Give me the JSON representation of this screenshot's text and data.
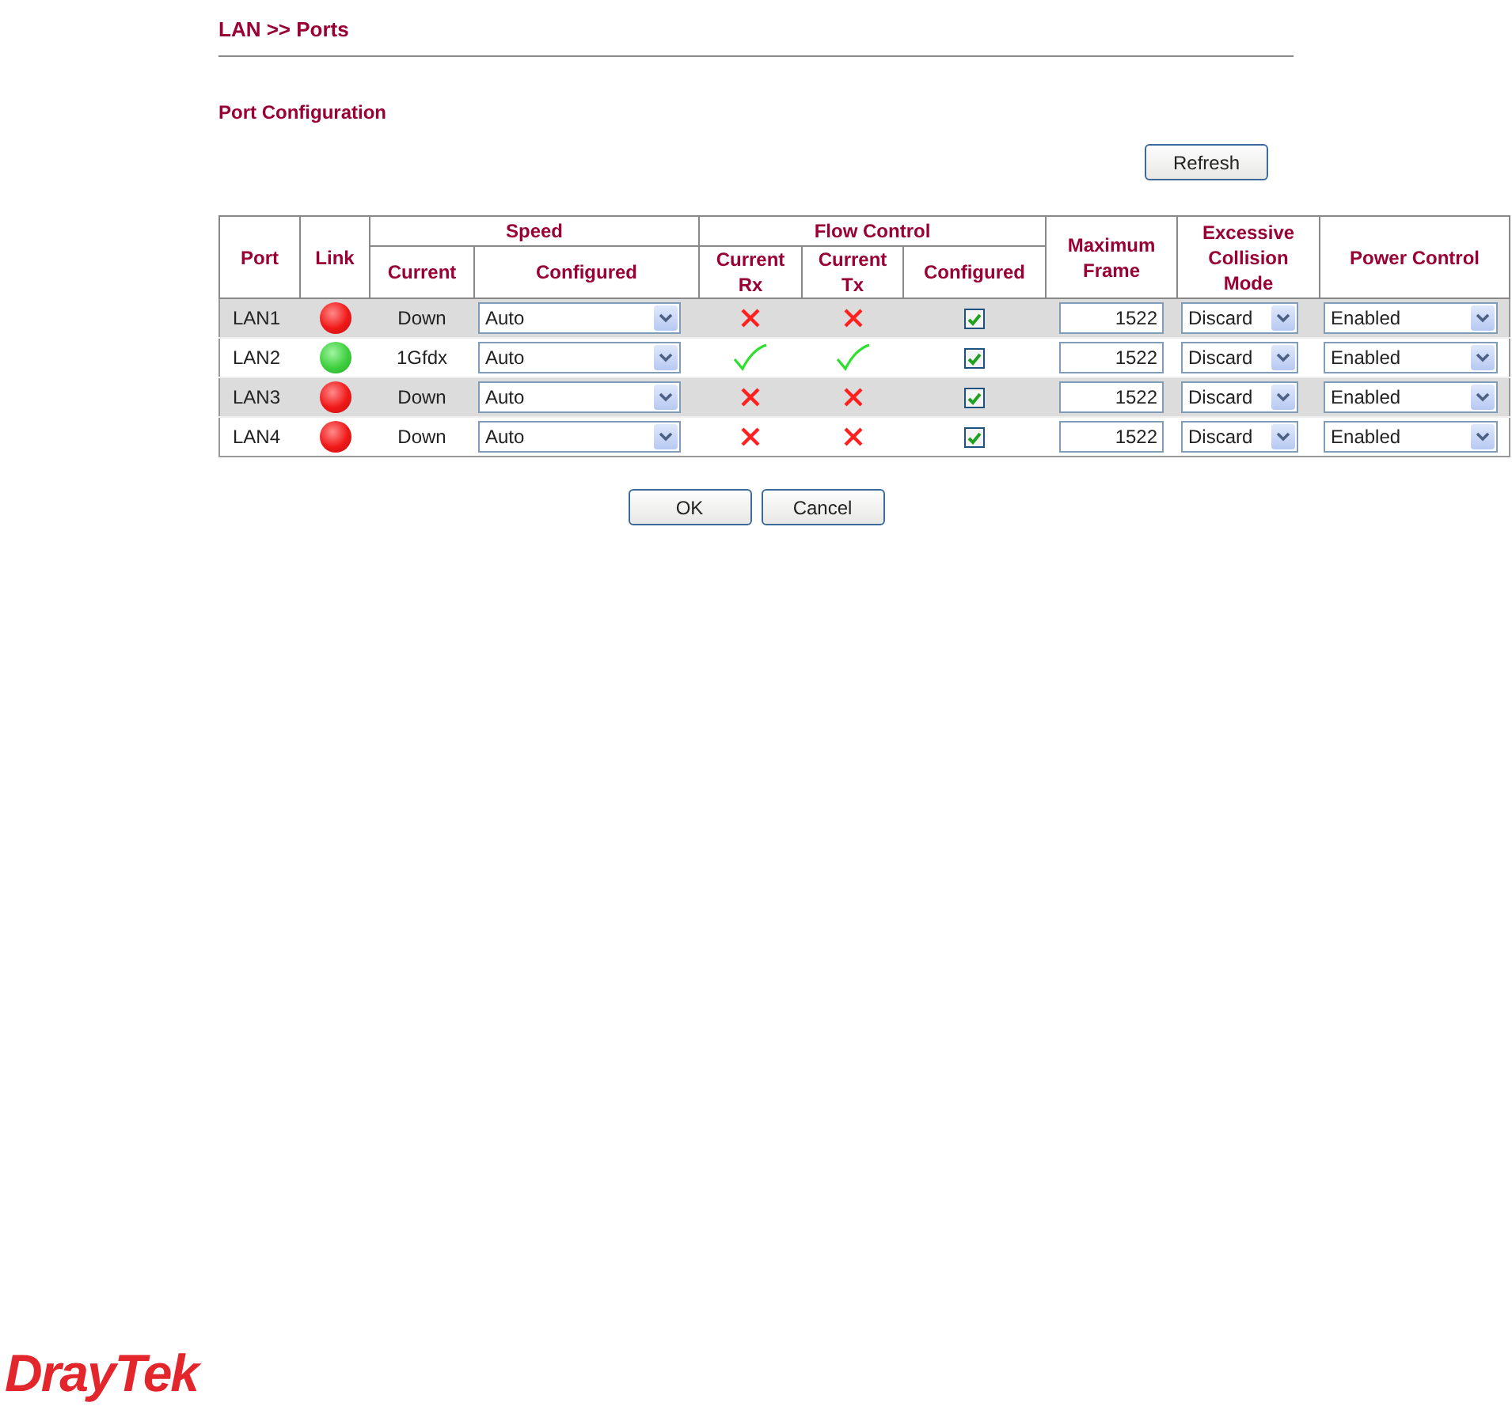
{
  "breadcrumb": "LAN >> Ports",
  "section_title": "Port Configuration",
  "refresh_button": "Refresh",
  "table": {
    "headers": {
      "port": "Port",
      "link": "Link",
      "speed": "Speed",
      "speed_current": "Current",
      "speed_configured": "Configured",
      "flow_control": "Flow Control",
      "flow_rx": "Current Rx",
      "flow_tx": "Current Tx",
      "flow_configured": "Configured",
      "max_frame": "Maximum Frame",
      "collision": "Excessive Collision Mode",
      "power": "Power Control"
    },
    "rows": [
      {
        "port": "LAN1",
        "link_up": false,
        "speed_current": "Down",
        "speed_configured": "Auto",
        "rx": false,
        "tx": false,
        "flow_checked": true,
        "max_frame": "1522",
        "collision": "Discard",
        "power": "Enabled"
      },
      {
        "port": "LAN2",
        "link_up": true,
        "speed_current": "1Gfdx",
        "speed_configured": "Auto",
        "rx": true,
        "tx": true,
        "flow_checked": true,
        "max_frame": "1522",
        "collision": "Discard",
        "power": "Enabled"
      },
      {
        "port": "LAN3",
        "link_up": false,
        "speed_current": "Down",
        "speed_configured": "Auto",
        "rx": false,
        "tx": false,
        "flow_checked": true,
        "max_frame": "1522",
        "collision": "Discard",
        "power": "Enabled"
      },
      {
        "port": "LAN4",
        "link_up": false,
        "speed_current": "Down",
        "speed_configured": "Auto",
        "rx": false,
        "tx": false,
        "flow_checked": true,
        "max_frame": "1522",
        "collision": "Discard",
        "power": "Enabled"
      }
    ]
  },
  "buttons": [
    "OK",
    "Cancel"
  ],
  "logo": "DrayTek"
}
